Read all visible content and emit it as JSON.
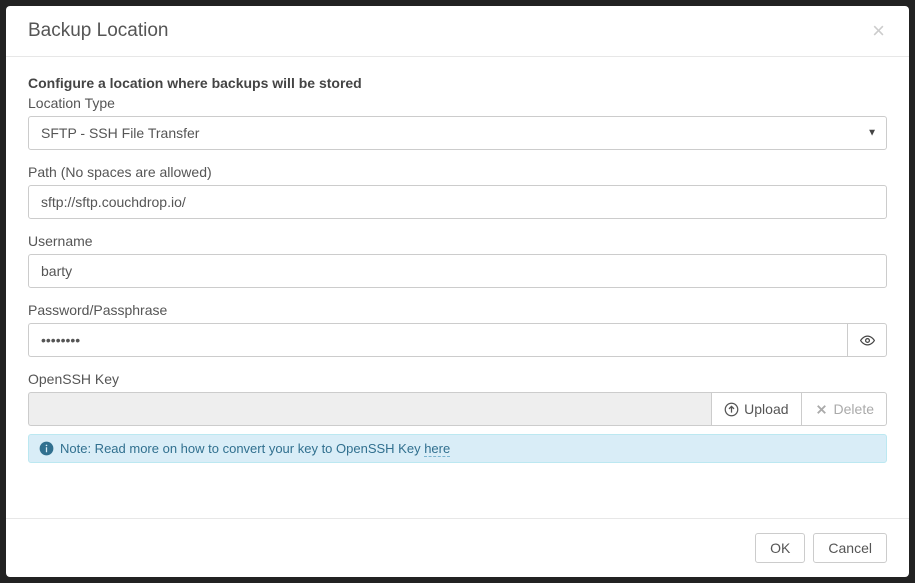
{
  "modal": {
    "title": "Backup Location",
    "close_label": "×"
  },
  "form": {
    "instruction": "Configure a location where backups will be stored",
    "location_type": {
      "label": "Location Type",
      "value": "SFTP - SSH File Transfer"
    },
    "path": {
      "label": "Path (No spaces are allowed)",
      "value": "sftp://sftp.couchdrop.io/"
    },
    "username": {
      "label": "Username",
      "value": "barty"
    },
    "password": {
      "label": "Password/Passphrase",
      "value": "••••••••"
    },
    "openssh": {
      "label": "OpenSSH Key",
      "upload_label": "Upload",
      "delete_label": "Delete"
    },
    "note": {
      "prefix": "Note: Read more on how to convert your key to OpenSSH Key ",
      "link_text": "here"
    }
  },
  "footer": {
    "ok_label": "OK",
    "cancel_label": "Cancel"
  }
}
